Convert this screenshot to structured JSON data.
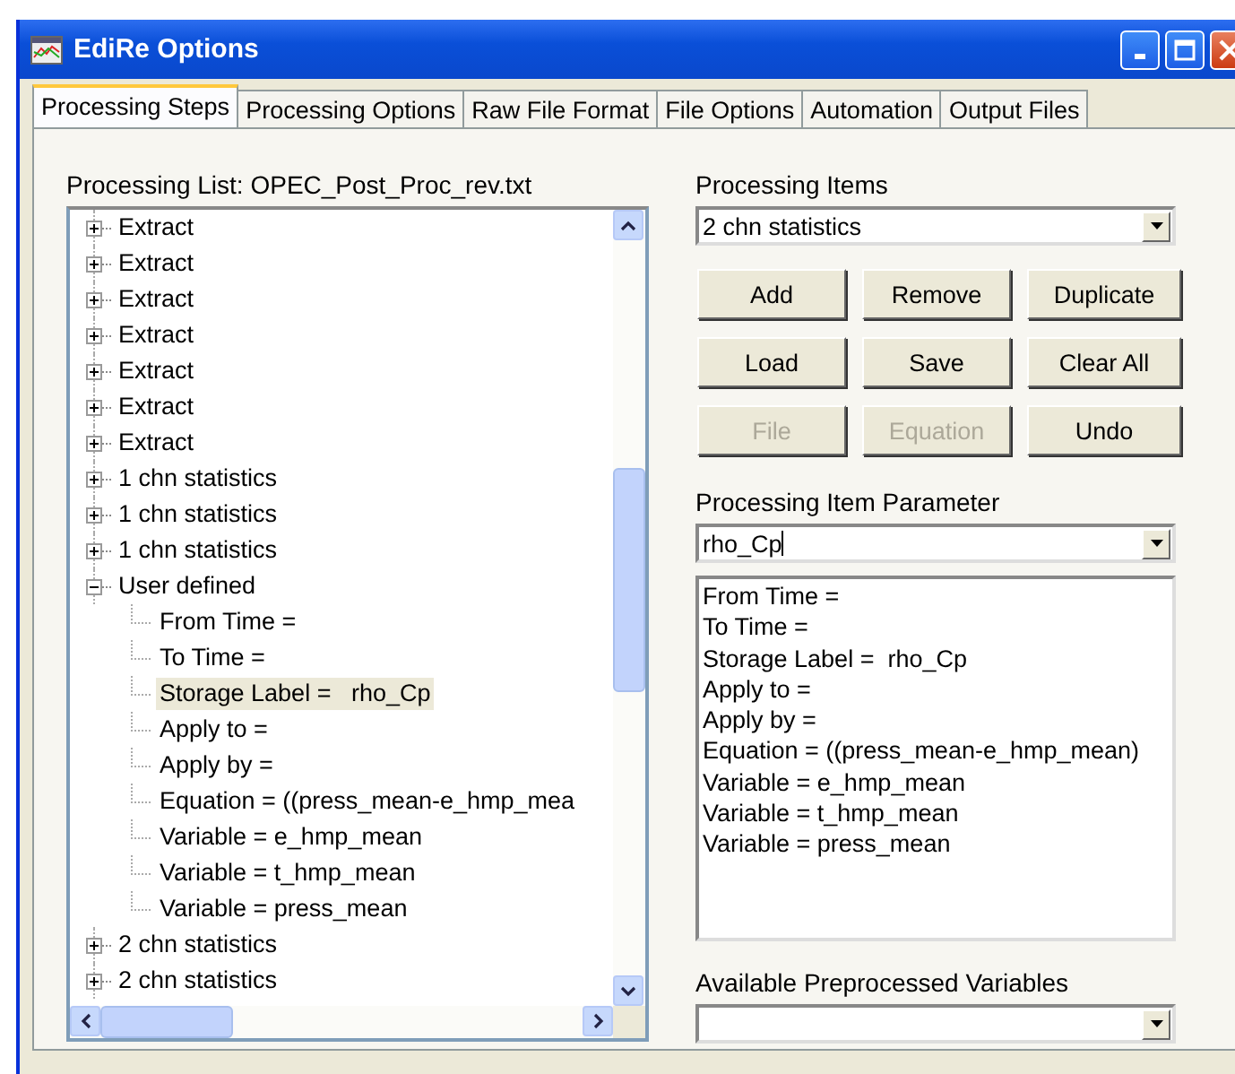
{
  "window": {
    "title": "EdiRe Options"
  },
  "tabs": [
    {
      "label": "Processing Steps",
      "selected": true
    },
    {
      "label": "Processing Options",
      "selected": false
    },
    {
      "label": "Raw File Format",
      "selected": false
    },
    {
      "label": "File Options",
      "selected": false
    },
    {
      "label": "Automation",
      "selected": false
    },
    {
      "label": "Output Files",
      "selected": false
    }
  ],
  "processing_list": {
    "label": "Processing List: OPEC_Post_Proc_rev.txt",
    "items": [
      {
        "label": "Extract",
        "expanded": false,
        "selected": false
      },
      {
        "label": "Extract",
        "expanded": false,
        "selected": false
      },
      {
        "label": "Extract",
        "expanded": false,
        "selected": false
      },
      {
        "label": "Extract",
        "expanded": false,
        "selected": false
      },
      {
        "label": "Extract",
        "expanded": false,
        "selected": false
      },
      {
        "label": "Extract",
        "expanded": false,
        "selected": false
      },
      {
        "label": "Extract",
        "expanded": false,
        "selected": false
      },
      {
        "label": "1 chn statistics",
        "expanded": false,
        "selected": false
      },
      {
        "label": "1 chn statistics",
        "expanded": false,
        "selected": false
      },
      {
        "label": "1 chn statistics",
        "expanded": false,
        "selected": false
      },
      {
        "label": "User defined",
        "expanded": true,
        "selected": false,
        "children": [
          {
            "label": "From Time =",
            "selected": false
          },
          {
            "label": "To Time =",
            "selected": false
          },
          {
            "label": "Storage Label =   rho_Cp",
            "selected": true
          },
          {
            "label": "Apply to =",
            "selected": false
          },
          {
            "label": "Apply by =",
            "selected": false
          },
          {
            "label": "Equation = ((press_mean-e_hmp_mea",
            "selected": false
          },
          {
            "label": "Variable = e_hmp_mean",
            "selected": false
          },
          {
            "label": "Variable = t_hmp_mean",
            "selected": false
          },
          {
            "label": "Variable = press_mean",
            "selected": false
          }
        ]
      },
      {
        "label": "2 chn statistics",
        "expanded": false,
        "selected": false
      },
      {
        "label": "2 chn statistics",
        "expanded": false,
        "selected": false
      }
    ]
  },
  "processing_items": {
    "label": "Processing Items",
    "value": "2 chn statistics"
  },
  "buttons": [
    {
      "label": "Add",
      "disabled": false
    },
    {
      "label": "Remove",
      "disabled": false
    },
    {
      "label": "Duplicate",
      "disabled": false
    },
    {
      "label": "Load",
      "disabled": false
    },
    {
      "label": "Save",
      "disabled": false
    },
    {
      "label": "Clear All",
      "disabled": false
    },
    {
      "label": "File",
      "disabled": true
    },
    {
      "label": "Equation",
      "disabled": true
    },
    {
      "label": "Undo",
      "disabled": false
    }
  ],
  "processing_item_parameter": {
    "label": "Processing Item Parameter",
    "value": "rho_Cp",
    "lines": [
      "From Time =",
      "To Time =",
      "Storage Label =  rho_Cp",
      "Apply to =",
      "Apply by =",
      "Equation = ((press_mean-e_hmp_mean)",
      "Variable = e_hmp_mean",
      "Variable = t_hmp_mean",
      "Variable = press_mean"
    ]
  },
  "available_preprocessed_variables": {
    "label": "Available Preprocessed Variables"
  }
}
